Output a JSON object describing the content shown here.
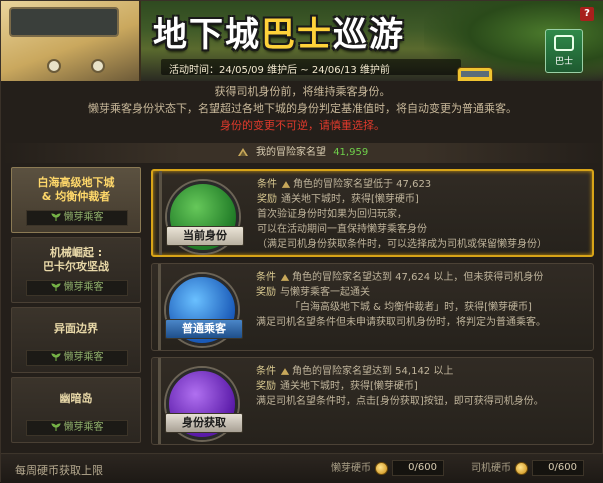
{
  "header": {
    "title_part1": "地下城",
    "title_accent": "巴士",
    "title_part2": "巡游",
    "period": "活动时间：24/05/09 维护后 ~ 24/06/13 维护前",
    "bus_button_label": "巴士",
    "help_label": "?"
  },
  "notice": {
    "line1": "获得司机身份前，将维持乘客身份。",
    "line2": "懒芽乘客身份状态下，名望超过各地下城的身份判定基准值时，将自动变更为普通乘客。",
    "warning": "身份的变更不可逆，请慎重选择。"
  },
  "fame": {
    "label": "我的冒险家名望",
    "value": "41,959"
  },
  "dungeons": [
    {
      "name_line1": "白海高级地下城",
      "name_line2": "& 均衡仲裁者",
      "status": "懒芽乘客"
    },
    {
      "name_line1": "机械崛起 :",
      "name_line2": "巴卡尔攻坚战",
      "status": "懒芽乘客"
    },
    {
      "name_line1": "异面边界",
      "name_line2": "",
      "status": "懒芽乘客"
    },
    {
      "name_line1": "幽暗岛",
      "name_line2": "",
      "status": "懒芽乘客"
    }
  ],
  "cards": [
    {
      "badge": "当前身份",
      "cond_key": "条件",
      "cond_text": "角色的冒险家名望低于 47,623",
      "reward_key": "奖励",
      "reward_text": "通关地下城时，获得[懒芽硬币]",
      "extra1": "首次验证身份时如果为回归玩家，",
      "extra2": "可以在活动期间一直保持懒芽乘客身份",
      "extra3": "（满足司机身份获取条件时，可以选择成为司机或保留懒芽身份）"
    },
    {
      "badge": "普通乘客",
      "cond_key": "条件",
      "cond_text": "角色的冒险家名望达到 47,624 以上，但未获得司机身份",
      "reward_key": "奖励",
      "reward_text": "与懒芽乘客一起通关",
      "reward_text2": "「白海高级地下城 & 均衡仲裁者」时，获得[懒芽硬币]",
      "extra1": "满足司机名望条件但未申请获取司机身份时，将判定为普通乘客。"
    },
    {
      "badge": "身份获取",
      "cond_key": "条件",
      "cond_text": "角色的冒险家名望达到 54,142 以上",
      "reward_key": "奖励",
      "reward_text": "通关地下城时，获得[懒芽硬币]",
      "extra1": "满足司机名望条件时，点击[身份获取]按钮，即可获得司机身份。"
    }
  ],
  "footer": {
    "label": "每周硬币获取上限",
    "lazy_coin_label": "懒芽硬币",
    "lazy_coin_value": "0/600",
    "driver_coin_label": "司机硬币",
    "driver_coin_value": "0/600"
  },
  "colors": {
    "accent_gold": "#d8a418",
    "warning_red": "#e03a2c",
    "fame_green": "#6fd04a"
  }
}
